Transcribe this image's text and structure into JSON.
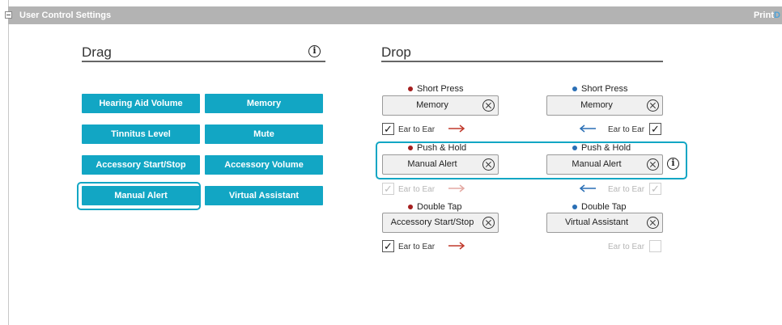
{
  "header": {
    "title": "User Control Settings",
    "print_label": "Print",
    "print_glyph": "D"
  },
  "drag": {
    "title": "Drag",
    "buttons": [
      "Hearing Aid Volume",
      "Memory",
      "Tinnitus Level",
      "Mute",
      "Accessory Start/Stop",
      "Accessory Volume",
      "Manual Alert",
      "Virtual Assistant"
    ],
    "selected": "Manual Alert"
  },
  "drop": {
    "title": "Drop",
    "ear_to_ear_label": "Ear to Ear",
    "left": [
      {
        "label": "Short Press",
        "value": "Memory",
        "ear_to_ear_checked": true,
        "ear_to_ear_enabled": true
      },
      {
        "label": "Push & Hold",
        "value": "Manual Alert",
        "ear_to_ear_checked": true,
        "ear_to_ear_enabled": false
      },
      {
        "label": "Double Tap",
        "value": "Accessory Start/Stop",
        "ear_to_ear_checked": true,
        "ear_to_ear_enabled": true
      }
    ],
    "right": [
      {
        "label": "Short Press",
        "value": "Memory",
        "ear_to_ear_checked": true,
        "ear_to_ear_enabled": true
      },
      {
        "label": "Push & Hold",
        "value": "Manual Alert",
        "ear_to_ear_checked": true,
        "ear_to_ear_enabled": false
      },
      {
        "label": "Double Tap",
        "value": "Virtual Assistant",
        "ear_to_ear_checked": false,
        "ear_to_ear_enabled": false
      }
    ]
  },
  "colors": {
    "accent": "#12a6c4",
    "left_dot": "#a51f1f",
    "right_dot": "#2a6fb5",
    "header_bg": "#b3b3b3"
  },
  "icons": {
    "check": "✓",
    "info": "i"
  }
}
